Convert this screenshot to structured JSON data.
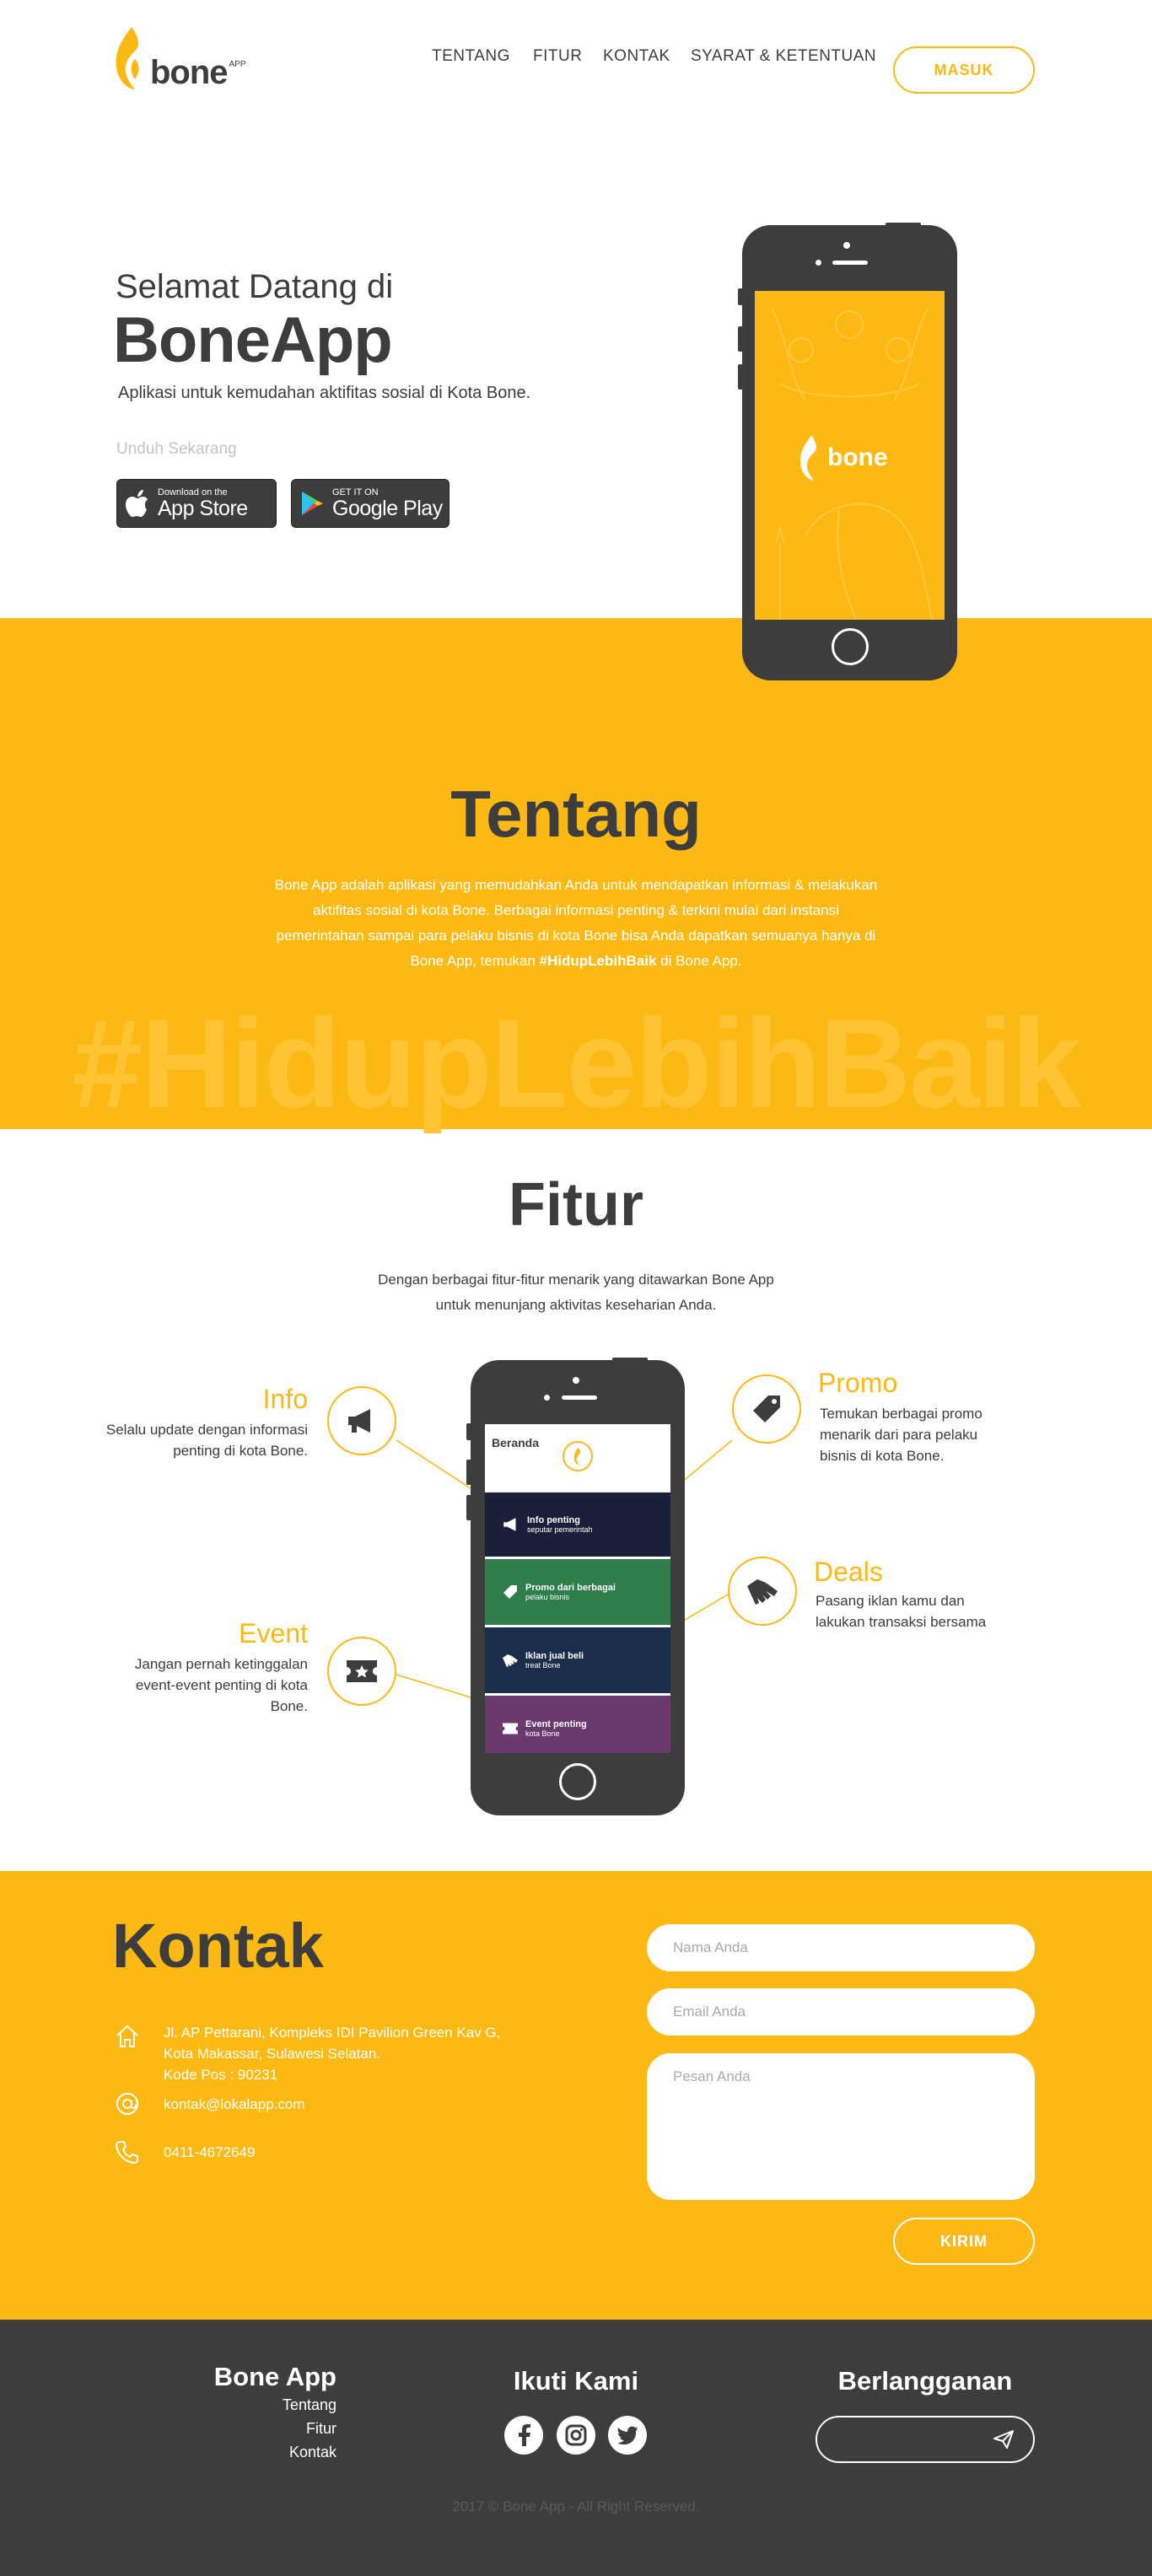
{
  "brand": {
    "name": "bone",
    "suffix": "APP",
    "accent": "#fdb913",
    "dark": "#3d3d3d"
  },
  "nav": {
    "items": [
      "TENTANG",
      "FITUR",
      "KONTAK",
      "SYARAT & KETENTUAN"
    ],
    "login": "MASUK"
  },
  "hero": {
    "subtitle": "Selamat Datang di",
    "title": "BoneApp",
    "description": "Aplikasi untuk kemudahan aktifitas sosial di Kota Bone.",
    "download_label": "Unduh Sekarang",
    "app_store": {
      "small": "Download on the",
      "big": "App Store"
    },
    "google_play": {
      "small": "GET IT ON",
      "big": "Google Play"
    },
    "splash_logo": "bone"
  },
  "tentang": {
    "title": "Tentang",
    "text_before": "Bone App adalah aplikasi yang memudahkan Anda untuk mendapatkan informasi & melakukan aktifitas sosial di kota Bone. Berbagai informasi penting & terkini mulai dari instansi pemerintahan sampai para pelaku bisnis di kota Bone bisa Anda dapatkan semuanya hanya di Bone App, temukan ",
    "hashtag": "#HidupLebihBaik",
    "text_after": " di Bone App.",
    "watermark": "#HidupLebihBaik"
  },
  "fitur": {
    "title": "Fitur",
    "description": "Dengan berbagai fitur-fitur menarik yang ditawarkan Bone App untuk menunjang aktivitas keseharian Anda.",
    "info": {
      "title": "Info",
      "text": "Selalu update dengan informasi penting di kota Bone."
    },
    "event": {
      "title": "Event",
      "text": "Jangan pernah ketinggalan event-event penting di kota Bone."
    },
    "promo": {
      "title": "Promo",
      "text": "Temukan berbagai promo menarik dari para pelaku bisnis di kota Bone."
    },
    "deals": {
      "title": "Deals",
      "text": "Pasang iklan kamu dan lakukan transaksi bersama"
    },
    "app_screen": {
      "header": "Beranda",
      "cards": [
        {
          "title": "Info penting",
          "sub": "seputar pemerintah"
        },
        {
          "title": "Promo dari berbagai",
          "sub": "pelaku bisnis"
        },
        {
          "title": "Iklan jual beli",
          "sub": "treat Bone"
        },
        {
          "title": "Event penting",
          "sub": "kota Bone"
        }
      ]
    }
  },
  "kontak": {
    "title": "Kontak",
    "address": [
      "Jl. AP Pettarani, Kompleks IDI Pavilion Green Kav G,",
      "Kota Makassar, Sulawesi Selatan.",
      "Kode Pos : 90231"
    ],
    "email": "kontak@lokalapp.com",
    "phone": "0411-4672649",
    "form": {
      "name_placeholder": "Nama Anda",
      "email_placeholder": "Email Anda",
      "message_placeholder": "Pesan Anda",
      "submit": "KIRIM"
    }
  },
  "footer": {
    "brand_title": "Bone App",
    "links": [
      "Tentang",
      "Fitur",
      "Kontak"
    ],
    "follow_title": "Ikuti Kami",
    "subscribe_title": "Berlangganan",
    "copyright": "2017 © Bone App - All Right Reserved."
  }
}
